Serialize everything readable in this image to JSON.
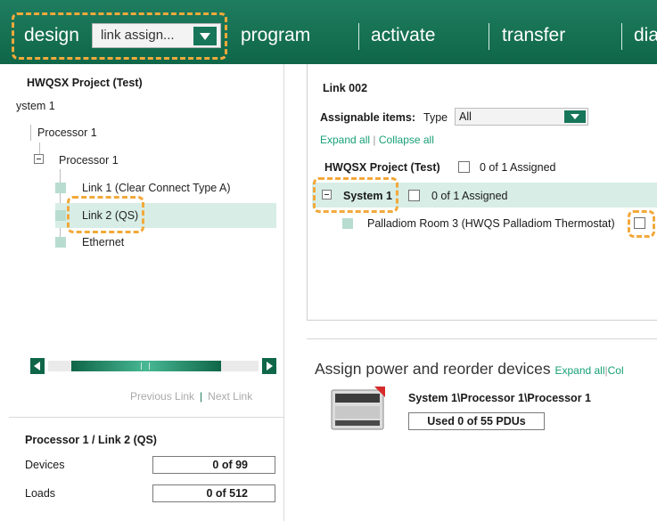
{
  "nav": {
    "tabs": [
      "design",
      "program",
      "activate",
      "transfer",
      "dia"
    ],
    "mode_select": {
      "value": "link assign..."
    },
    "colors": {
      "bar": "#0f6648",
      "highlight": "#f2a93b",
      "selected_row": "#d7ede6",
      "link": "#17a075"
    }
  },
  "left_panel": {
    "project_title": "HWQSX Project (Test)",
    "tree": {
      "system": "ystem 1",
      "processor_group": "Processor 1",
      "processor": "Processor 1",
      "links": [
        "Link 1 (Clear Connect Type A)",
        "Link 2 (QS)",
        "Ethernet"
      ],
      "selected": "Link 2 (QS)"
    },
    "nav_links": {
      "previous": "Previous Link",
      "separator": "|",
      "next": "Next Link"
    },
    "summary": {
      "title": "Processor 1 / Link 2 (QS)",
      "devices_label": "Devices",
      "devices_value": "0 of 99",
      "loads_label": "Loads",
      "loads_value": "0 of 512"
    }
  },
  "right_panel": {
    "link_title": "Link 002",
    "assignable_label": "Assignable items:",
    "type_label": "Type",
    "type_value": "All",
    "expand_all": "Expand all",
    "separator": "|",
    "collapse_all": "Collapse all",
    "project_name": "HWQSX Project (Test)",
    "project_assigned": "0 of 1 Assigned",
    "system_name": "System 1",
    "system_assigned": "0 of 1 Assigned",
    "room_item": "Palladiom Room 3 (HWQS Palladiom Thermostat)"
  },
  "assign_section": {
    "title": "Assign power and reorder devices",
    "expand_all": "Expand all",
    "collapse_partial": "Col",
    "separator": "|",
    "device_path": "System 1\\Processor 1\\Processor 1",
    "used": "Used 0 of 55 PDUs"
  }
}
